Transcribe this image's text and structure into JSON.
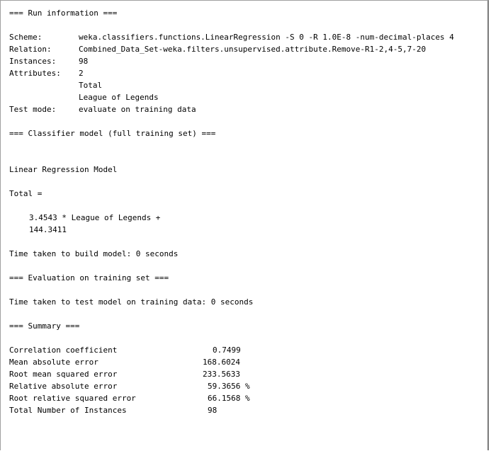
{
  "run_info": {
    "header": "=== Run information ===",
    "scheme_label": "Scheme:",
    "scheme_value": "weka.classifiers.functions.LinearRegression -S 0 -R 1.0E-8 -num-decimal-places 4",
    "relation_label": "Relation:",
    "relation_value": "Combined_Data_Set-weka.filters.unsupervised.attribute.Remove-R1-2,4-5,7-20",
    "instances_label": "Instances:",
    "instances_value": "98",
    "attributes_label": "Attributes:",
    "attributes_value": "2",
    "attribute_list": [
      "Total",
      "League of Legends"
    ],
    "test_mode_label": "Test mode:",
    "test_mode_value": "evaluate on training data"
  },
  "classifier_model": {
    "header": "=== Classifier model (full training set) ===",
    "model_title": "Linear Regression Model",
    "target_line": "Total =",
    "coefficient_line": "3.4543 * League of Legends +",
    "intercept_line": "144.3411",
    "time_build": "Time taken to build model: 0 seconds"
  },
  "evaluation": {
    "header": "=== Evaluation on training set ===",
    "time_test": "Time taken to test model on training data: 0 seconds"
  },
  "summary": {
    "header": "=== Summary ===",
    "rows": [
      {
        "label": "Correlation coefficient",
        "value": "0.7499"
      },
      {
        "label": "Mean absolute error",
        "value": "168.6024"
      },
      {
        "label": "Root mean squared error",
        "value": "233.5633"
      },
      {
        "label": "Relative absolute error",
        "value": "59.3656 %"
      },
      {
        "label": "Root relative squared error",
        "value": "66.1568 %"
      },
      {
        "label": "Total Number of Instances",
        "value": "98"
      }
    ]
  }
}
